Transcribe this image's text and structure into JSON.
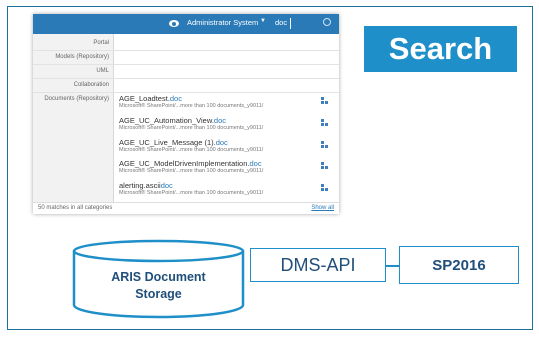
{
  "header": {
    "user_menu": "Administrator System",
    "search_value": "doc"
  },
  "categories": [
    {
      "label": "Portal"
    },
    {
      "label": "Models (Repository)"
    },
    {
      "label": "UML"
    },
    {
      "label": "Collaboration"
    },
    {
      "label": "Documents (Repository)"
    }
  ],
  "results": [
    {
      "name": "AGE_Loadtest.",
      "ext": "doc",
      "source": "Microsoft® SharePoint/...more than 100 documents_y9011/"
    },
    {
      "name": "AGE_UC_Automation_View.",
      "ext": "doc",
      "source": "Microsoft® SharePoint/...more than 100 documents_y9011/"
    },
    {
      "name": "AGE_UC_Live_Message (1).",
      "ext": "doc",
      "source": "Microsoft® SharePoint/...more than 100 documents_y9011/"
    },
    {
      "name": "AGE_UC_ModelDrivenImplementation.",
      "ext": "doc",
      "source": "Microsoft® SharePoint/...more than 100 documents_y9011/"
    },
    {
      "name": "alerting.ascii",
      "ext": "doc",
      "source": "Microsoft® SharePoint/...more than 100 documents_y9011/"
    }
  ],
  "footer": {
    "matches_text": "50 matches in all categories",
    "show_all": "Show all"
  },
  "search_badge": "Search",
  "diagram": {
    "storage_line1": "ARIS Document",
    "storage_line2": "Storage",
    "api": "DMS-API",
    "target": "SP2016"
  },
  "colors": {
    "topbar": "#2a7ab8",
    "accent": "#1f8fc9",
    "frame": "#1f6f9e",
    "label_text": "#1f4f7a"
  },
  "icons": [
    "eye-icon",
    "chevron-down-icon",
    "search-icon",
    "document-type-icon"
  ]
}
